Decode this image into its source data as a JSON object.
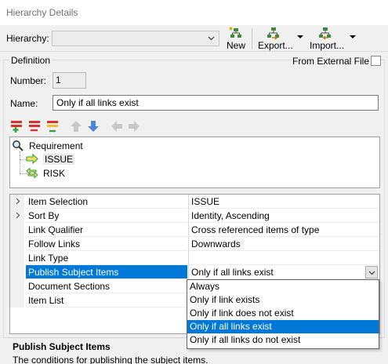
{
  "window": {
    "title": "Hierarchy Details"
  },
  "toolbar": {
    "hierarchy_label": "Hierarchy:",
    "hierarchy_value": "",
    "new_label": "New",
    "export_label": "Export...",
    "import_label": "Import..."
  },
  "definition": {
    "group_title": "Definition",
    "external_label": "From External File",
    "external_checked": false,
    "number_label": "Number:",
    "number_value": "1",
    "name_label": "Name:",
    "name_value": "Only if all links exist"
  },
  "tree": {
    "root": "Requirement",
    "children": [
      "ISSUE",
      "RISK"
    ]
  },
  "properties": [
    {
      "name": "Item Selection",
      "value": "ISSUE",
      "expandable": true
    },
    {
      "name": "Sort By",
      "value": "Identity, Ascending",
      "expandable": true
    },
    {
      "name": "Link Qualifier",
      "value": "Cross referenced items of type",
      "expandable": false
    },
    {
      "name": "Follow Links",
      "value": "Downwards",
      "expandable": false
    },
    {
      "name": "Link Type",
      "value": "",
      "expandable": false
    },
    {
      "name": "Publish Subject Items",
      "value": "Only if all links exist",
      "expandable": false,
      "selected": true
    },
    {
      "name": "Document Sections",
      "value": "",
      "expandable": false
    },
    {
      "name": "Item List",
      "value": "",
      "expandable": false
    }
  ],
  "dropdown": {
    "options": [
      "Always",
      "Only if link exists",
      "Only if link does not exist",
      "Only if all links exist",
      "Only if all links do not exist"
    ],
    "highlighted": "Only if all links exist"
  },
  "description": {
    "title": "Publish Subject Items",
    "text": "The conditions for publishing the subject items."
  },
  "colors": {
    "selection": "#0078d7",
    "panel": "#f0f0f0",
    "add_green": "#3aa13a",
    "remove_red": "#d9312b",
    "nav_blue": "#4a86d6"
  },
  "icons": [
    "chevron-down-icon",
    "new-hierarchy-icon",
    "export-icon",
    "import-icon",
    "add-level-icon",
    "remove-level-icon",
    "edit-level-icon",
    "move-up-icon",
    "move-down-icon",
    "move-left-icon",
    "move-right-icon",
    "search-icon",
    "link-arrow-icon",
    "link-bidirectional-icon",
    "expand-arrow-icon"
  ]
}
